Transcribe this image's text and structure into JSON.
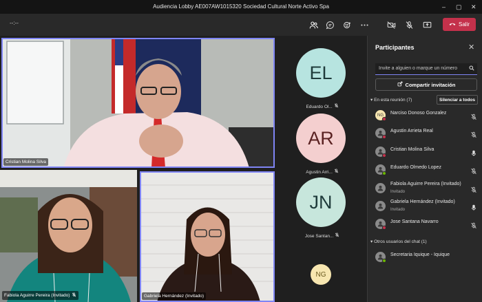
{
  "window": {
    "title": "Audiencia Lobby AE007AW1015320 Sociedad Cultural Norte Activo Spa"
  },
  "toolbar": {
    "timer": "--:--",
    "leave_label": "Salir"
  },
  "videos": [
    {
      "name": "Cristian Molina Silva"
    },
    {
      "name": "Fabiola Aguirre Pereira (Invitado)"
    },
    {
      "name": "Gabriela Hernández (Invitado)"
    }
  ],
  "avatars": [
    {
      "initials": "EL",
      "name": "Eduardo Ol...",
      "color": "#b7e4e0"
    },
    {
      "initials": "AR",
      "name": "Agustin Arri...",
      "color": "#f4cfcf"
    },
    {
      "initials": "JN",
      "name": "Jose Santan...",
      "color": "#c7e6dc"
    },
    {
      "initials": "NG",
      "name": "",
      "color": "#f7e6b0"
    }
  ],
  "panel": {
    "title": "Participantes",
    "invite_placeholder": "Invite a alguien o marque un número",
    "share_label": "Compartir invitación",
    "in_meeting_label": "En esta reunión (7)",
    "mute_all_label": "Silenciar a todos",
    "others_label": "Otros usuarios del chat (1)",
    "participants": [
      {
        "name": "Narciso Donoso Gonzalez",
        "initials": "NG",
        "sub": "",
        "mic": "muted",
        "avatar_color": "#f7e6b0",
        "status_color": "#c4314b"
      },
      {
        "name": "Agustin Arrieta Real",
        "initials": "",
        "sub": "",
        "mic": "muted",
        "avatar_color": "#8a8a8a",
        "status_color": "#c4314b"
      },
      {
        "name": "Cristian Molina Silva",
        "initials": "",
        "sub": "",
        "mic": "on",
        "avatar_color": "#8a8a8a",
        "status_color": "#c4314b"
      },
      {
        "name": "Eduardo Olmedo Lopez",
        "initials": "",
        "sub": "",
        "mic": "muted",
        "avatar_color": "#8a8a8a",
        "status_color": "#6bb700"
      },
      {
        "name": "Fabiola Aguirre Pereira (Invitado)",
        "initials": "",
        "sub": "Invitado",
        "mic": "muted",
        "avatar_color": "#8a8a8a",
        "status_color": ""
      },
      {
        "name": "Gabriela Hernández (Invitado)",
        "initials": "",
        "sub": "Invitado",
        "mic": "on",
        "avatar_color": "#8a8a8a",
        "status_color": ""
      },
      {
        "name": "Jose Santana Navarro",
        "initials": "",
        "sub": "",
        "mic": "muted",
        "avatar_color": "#8a8a8a",
        "status_color": "#c4314b"
      }
    ],
    "others": [
      {
        "name": "Secretaria Iquique - Iquique",
        "initials": "",
        "avatar_color": "#8a8a8a",
        "status_color": "#6bb700"
      }
    ]
  }
}
